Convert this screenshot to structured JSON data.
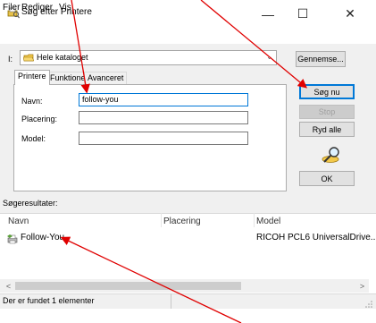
{
  "window": {
    "title": "Søg efter Printere",
    "minimize": "—",
    "maximize": "☐",
    "close": "✕"
  },
  "menu": [
    "Filer",
    "Rediger",
    "Vis"
  ],
  "in_label": "I:",
  "location": {
    "value": "Hele kataloget",
    "icon": "directory-icon"
  },
  "buttons": {
    "browse": "Gennemse...",
    "search": "Søg nu",
    "stop": "Stop",
    "clear": "Ryd alle",
    "ok": "OK"
  },
  "tabs": [
    "Printere",
    "Funktioner",
    "Avanceret"
  ],
  "fields": {
    "name_label": "Navn:",
    "name_value": "follow-you",
    "location_label": "Placering:",
    "location_value": "",
    "model_label": "Model:",
    "model_value": ""
  },
  "results_label": "Søgeresultater:",
  "results": {
    "columns": [
      "Navn",
      "Placering",
      "Model"
    ],
    "rows": [
      {
        "name": "Follow-You",
        "location": "",
        "model": "RICOH PCL6 UniversalDrive..."
      }
    ]
  },
  "scrollbar": {
    "left_arrow": "<",
    "right_arrow": ">"
  },
  "status": "Der er fundet 1 elementer",
  "colors": {
    "accent": "#0078d7",
    "annotation_arrow": "#e00000",
    "dialog_bg": "#f0f0f0"
  }
}
